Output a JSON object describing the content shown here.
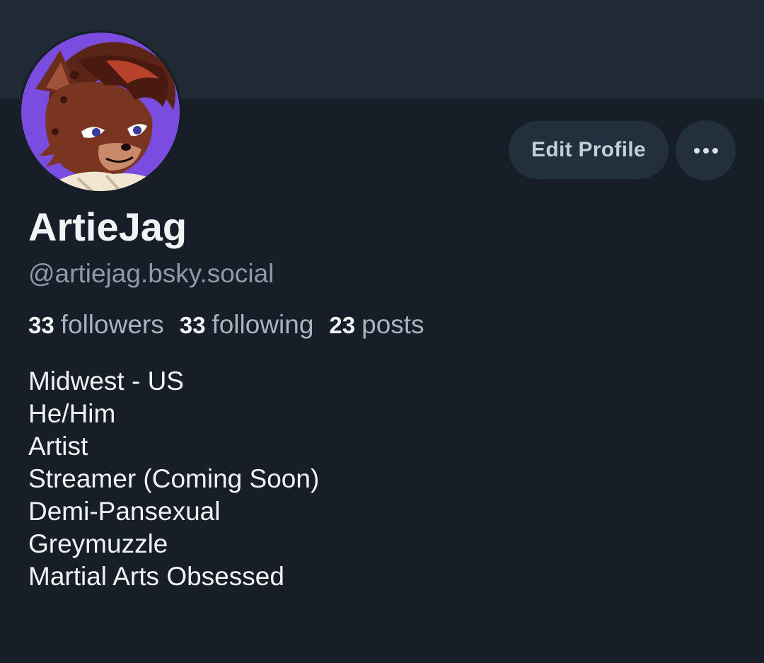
{
  "profile": {
    "display_name": "ArtieJag",
    "handle": "@artiejag.bsky.social",
    "avatar_icon": "wolf-character-avatar",
    "stats": [
      {
        "count": "33",
        "label": "followers"
      },
      {
        "count": "33",
        "label": "following"
      },
      {
        "count": "23",
        "label": "posts"
      }
    ],
    "bio": [
      "Midwest - US",
      "He/Him",
      "Artist",
      "Streamer (Coming Soon)",
      "Demi-Pansexual",
      "Greymuzzle",
      "Martial Arts Obsessed"
    ]
  },
  "actions": {
    "edit_label": "Edit Profile",
    "more_icon": "ellipsis-icon"
  },
  "colors": {
    "background": "#161e27",
    "banner": "#1f2a35",
    "button": "#232f3c",
    "avatar_bg": "#7a4de0"
  }
}
